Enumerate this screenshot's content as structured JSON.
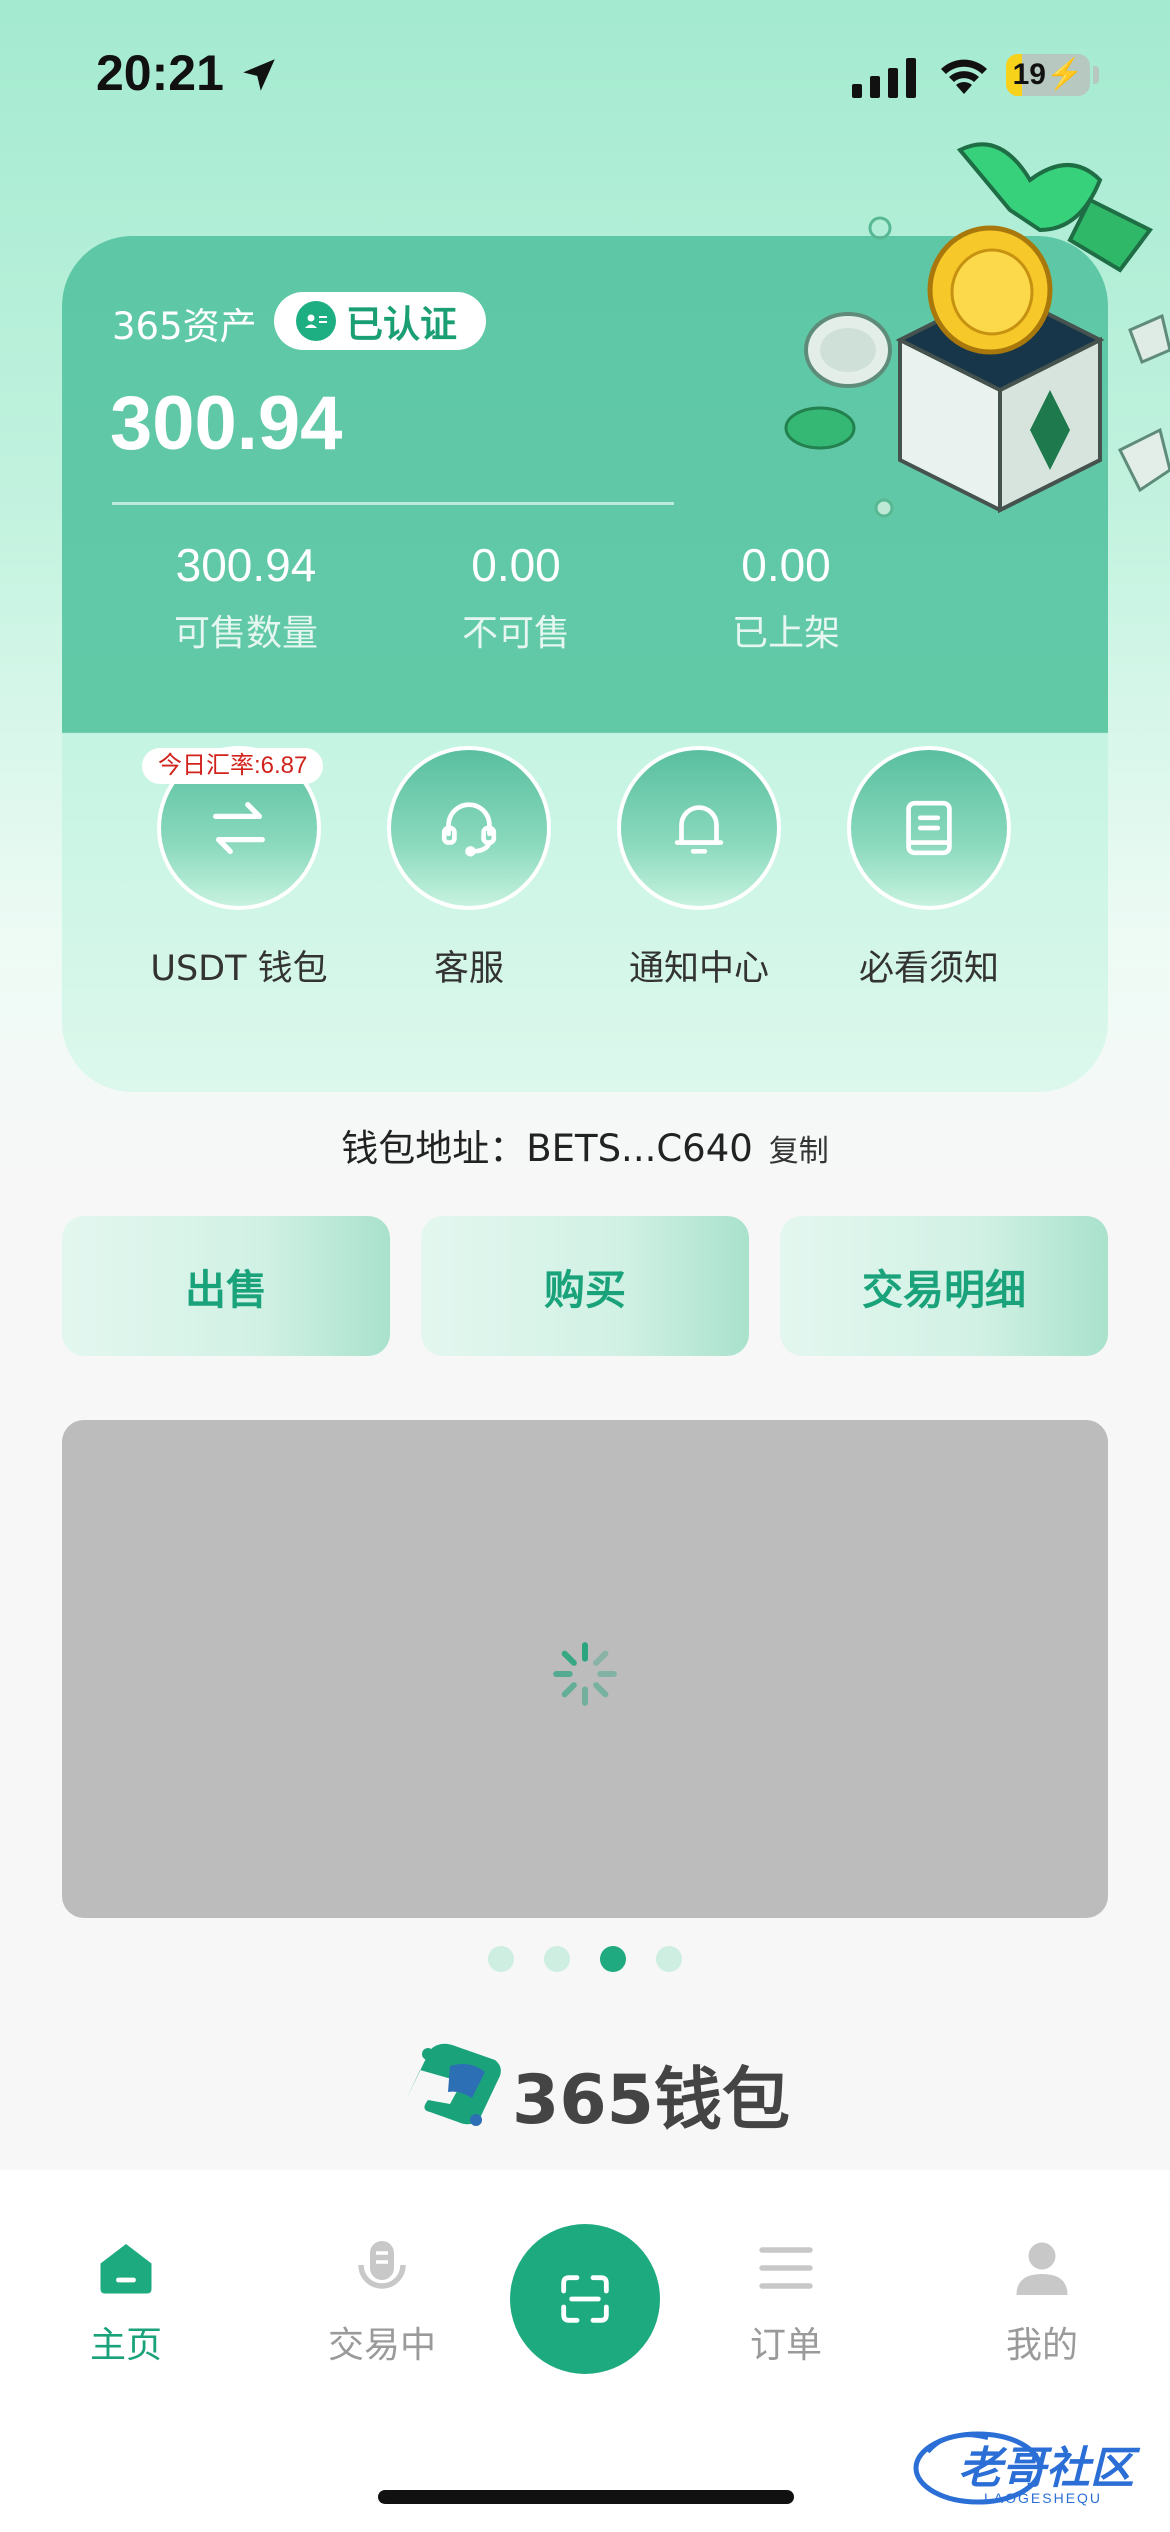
{
  "status_bar": {
    "time": "20:21",
    "battery": "19",
    "battery_level": 0.19
  },
  "asset_card": {
    "label": "365资产",
    "verified": "已认证",
    "balance": "300.94",
    "stats": [
      {
        "value": "300.94",
        "label": "可售数量"
      },
      {
        "value": "0.00",
        "label": "不可售"
      },
      {
        "value": "0.00",
        "label": "已上架"
      }
    ],
    "rate_badge": "今日汇率:6.87",
    "quick_actions": [
      {
        "label": "USDT 钱包",
        "icon": "swap-arrows-icon"
      },
      {
        "label": "客服",
        "icon": "headset-icon"
      },
      {
        "label": "通知中心",
        "icon": "bell-icon"
      },
      {
        "label": "必看须知",
        "icon": "notebook-icon"
      }
    ]
  },
  "wallet": {
    "prefix": "钱包地址：",
    "address": "BETS...C640",
    "copy": "复制"
  },
  "actions": [
    "出售",
    "购买",
    "交易明细"
  ],
  "carousel": {
    "count": 4,
    "active_index": 2
  },
  "logo": {
    "text": "365钱包"
  },
  "bottom_nav": [
    {
      "label": "主页",
      "icon": "home-icon",
      "active": true
    },
    {
      "label": "交易中",
      "icon": "microphone-icon",
      "active": false
    },
    {
      "label": "订单",
      "icon": "list-icon",
      "active": false
    },
    {
      "label": "我的",
      "icon": "user-icon",
      "active": false
    }
  ],
  "scan_icon": "scan-icon",
  "watermark": {
    "text": "老哥社区",
    "sub": "LAOGESHEQU"
  },
  "colors": {
    "accent": "#1daa7f",
    "card": "#5ec8a6",
    "banner": "#bcbcbc"
  }
}
